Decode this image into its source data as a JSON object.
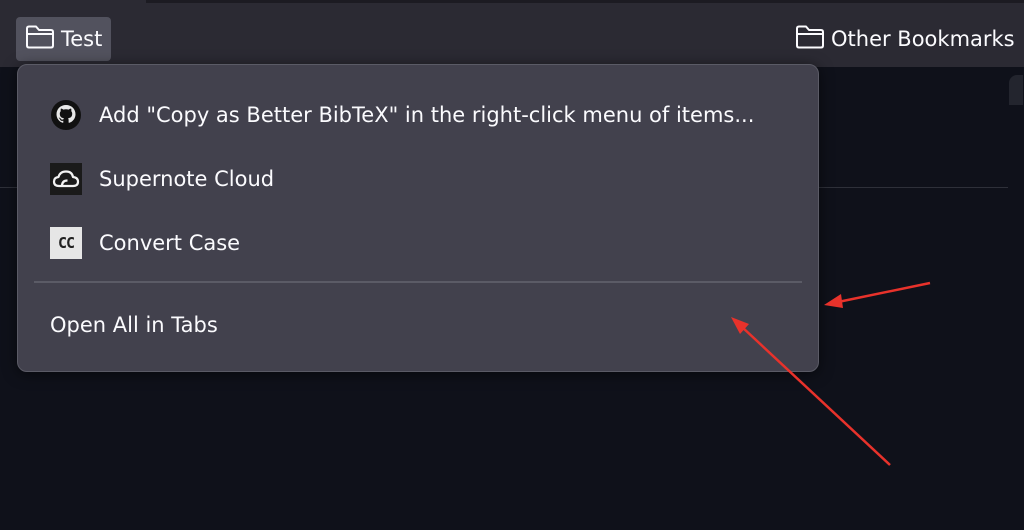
{
  "bookmarks_bar": {
    "folders": [
      {
        "label": "Test",
        "icon": "folder-icon",
        "state": "open"
      },
      {
        "label": "Other Bookmarks",
        "icon": "folder-icon"
      }
    ]
  },
  "folder_menu": {
    "items": [
      {
        "label": "Add \"Copy as Better BibTeX\" in the right-click menu of items...",
        "icon": "github-icon"
      },
      {
        "label": "Supernote Cloud",
        "icon": "cloud-icon"
      },
      {
        "label": "Convert Case",
        "icon": "convert-case-icon",
        "icon_text": "CC"
      }
    ],
    "open_all_label": "Open All in Tabs"
  },
  "colors": {
    "toolbar": "#2b2a33",
    "menu_bg": "#42414d",
    "page_bg": "#0f111a",
    "annotation_arrow": "#e8322b"
  }
}
